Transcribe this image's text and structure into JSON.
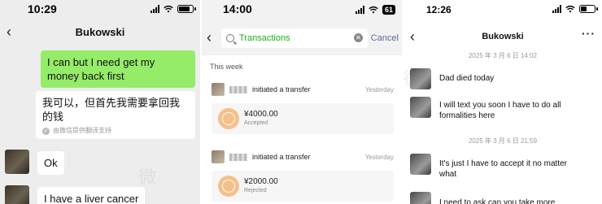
{
  "panel1": {
    "time": "10:29",
    "title": "Bukowski",
    "messages": [
      {
        "from": "me",
        "text": "I can but I need get my money back first"
      },
      {
        "from": "them",
        "text": "我可以，但首先我需要拿回我的钱",
        "note": "由微信提供翻译支持"
      },
      {
        "from": "them",
        "text": "Ok"
      },
      {
        "from": "them",
        "text": "I have a liver cancer"
      }
    ]
  },
  "panel2": {
    "time": "14:00",
    "battery": "61",
    "search_query": "Transactions",
    "cancel_label": "Cancel",
    "section": "This week",
    "transfers": [
      {
        "action": "initiated a transfer",
        "date": "Yesterday",
        "amount": "¥4000.00",
        "status": "Accepted"
      },
      {
        "action": "initiated a transfer",
        "date": "Yesterday",
        "amount": "¥2000.00",
        "status": "Rejected"
      }
    ]
  },
  "panel3": {
    "time": "12:26",
    "title": "Bukowski",
    "more": "···",
    "timestamps": [
      "2025 年 3 月 6 日 14:02",
      "2025 年 3 月 6 日 21:59"
    ],
    "messages": [
      "Dad died today",
      "I will text you soon I have to do all formalities here",
      "It's just I have to accept it no matter what",
      "I need to ask can you take more"
    ]
  },
  "icons": {
    "back": "back-chevron-icon",
    "search": "search-icon",
    "clear": "clear-icon",
    "signal": "signal-icon",
    "wifi": "wifi-icon",
    "battery": "battery-icon"
  },
  "colors": {
    "my_bubble": "#95ec69",
    "their_bubble": "#ffffff",
    "chat_bg": "#ededed",
    "search_highlight": "#1aad19",
    "cancel_link": "#576b95"
  }
}
